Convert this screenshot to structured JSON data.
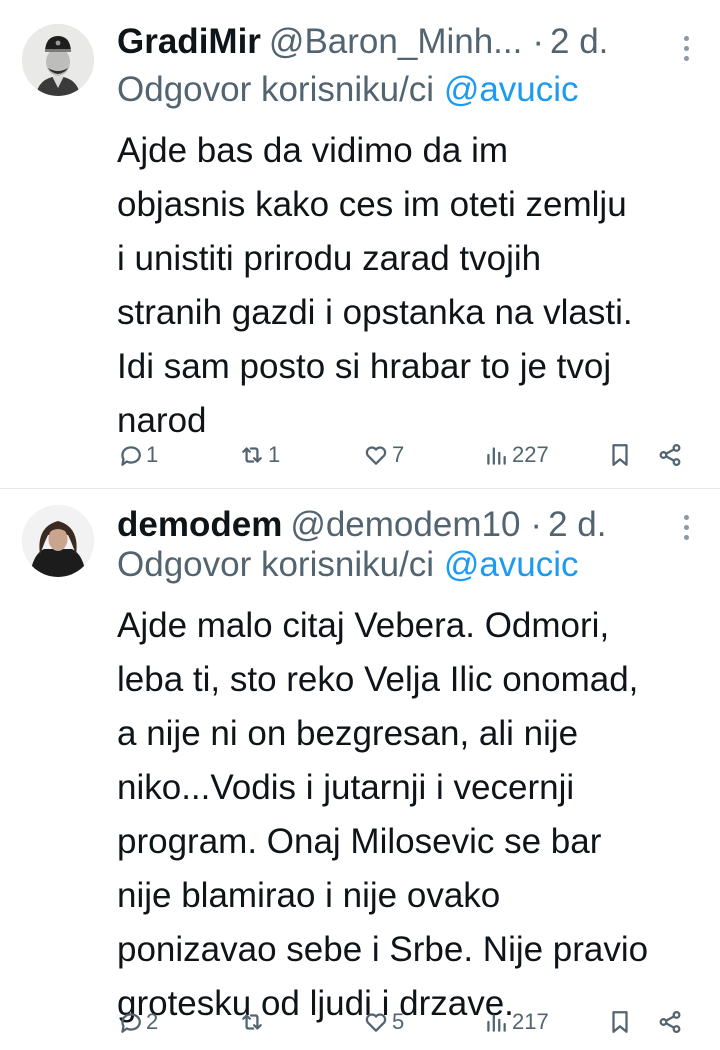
{
  "tweets": [
    {
      "name": "GradiMir",
      "handle": "@Baron_Minh...",
      "separator": "·",
      "time": "2 d.",
      "reply_prefix": "Odgovor korisniku/ci",
      "reply_mention": "@avucic",
      "lines": [
        "Ajde bas da vidimo da im",
        "objasnis kako ces im oteti zemlju",
        "i unistiti prirodu zarad tvojih",
        "stranih gazdi i opstanka na vlasti.",
        "Idi sam posto si hrabar to je tvoj",
        "narod"
      ],
      "replies": "1",
      "retweets": "1",
      "likes": "7",
      "views": "227",
      "icons": {
        "more": "more-icon",
        "reply": "reply-icon",
        "retweet": "retweet-icon",
        "like": "heart-icon",
        "views": "views-icon",
        "bookmark": "bookmark-icon",
        "share": "share-icon"
      }
    },
    {
      "name": "demodem",
      "handle": "@demodem10",
      "separator": "·",
      "time": "2 d.",
      "reply_prefix": "Odgovor korisniku/ci",
      "reply_mention": "@avucic",
      "lines": [
        "Ajde malo citaj Vebera. Odmori,",
        "leba ti, sto reko Velja Ilic onomad,",
        "a nije ni on bezgresan, ali nije",
        "niko...Vodis i jutarnji i vecernji",
        "program. Onaj Milosevic se bar",
        "nije blamirao i nije ovako",
        "ponizavao sebe i Srbe. Nije pravio",
        "grotesku od ljudi i drzave."
      ],
      "replies": "2",
      "retweets": "",
      "likes": "5",
      "views": "217"
    }
  ],
  "colors": {
    "text": "#0f1419",
    "secondary": "#536471",
    "link": "#1d9bf0",
    "divider": "#e6e9eb",
    "background": "#ffffff"
  }
}
